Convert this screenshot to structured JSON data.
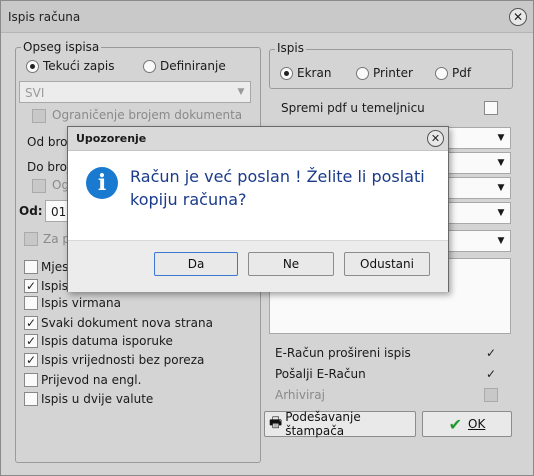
{
  "window": {
    "title": "Ispis računa"
  },
  "opseg": {
    "legend": "Opseg ispisa",
    "radio_tekuci": "Tekući zapis",
    "radio_definiranje": "Definiranje",
    "combo_value": "SVI",
    "ogranicenje_label": "Ograničenje brojem dokumenta",
    "od_broja": "Od broj",
    "do_broja": "Do broj",
    "og_label": "Og",
    "od_label": "Od:",
    "od_value": "01.",
    "za_label": "Za p",
    "mjes_label": "Mjes",
    "ispis_label": "Ispis"
  },
  "options": [
    {
      "label": "Ispis virmana",
      "checked": false
    },
    {
      "label": "Svaki dokument nova strana",
      "checked": true
    },
    {
      "label": "Ispis datuma isporuke",
      "checked": true
    },
    {
      "label": "Ispis vrijednosti bez poreza",
      "checked": true
    },
    {
      "label": "Prijevod na engl.",
      "checked": false
    },
    {
      "label": "Ispis u dvije valute",
      "checked": false
    }
  ],
  "ispis": {
    "legend": "Ispis",
    "radio_ekran": "Ekran",
    "radio_printer": "Printer",
    "radio_pdf": "Pdf",
    "spremi_label": "Spremi pdf u temeljnicu"
  },
  "right_checks": {
    "eracun_prosireni": "E-Račun prošireni ispis",
    "posalji_eracun": "Pošalji E-Račun",
    "arhiviraj": "Arhiviraj"
  },
  "buttons": {
    "podesavanje": "Podešavanje štampača",
    "ok": "OK"
  },
  "dialog": {
    "title": "Upozorenje",
    "message_line1": "Račun je već poslan ! Želite li poslati",
    "message_line2": "kopiju računa?",
    "btn_da": "Da",
    "btn_ne": "Ne",
    "btn_odustani": "Odustani"
  },
  "colors": {
    "accent": "#3a78d4",
    "info_icon": "#1a7ad0",
    "message_text": "#1a3a8a",
    "ok_check": "#1e9a2e"
  }
}
